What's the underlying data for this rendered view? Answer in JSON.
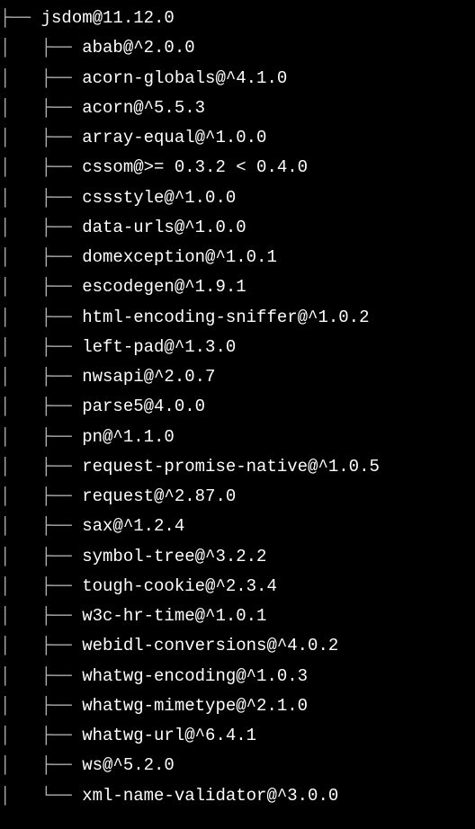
{
  "tree": {
    "root": "jsdom@11.12.0",
    "children": [
      "abab@^2.0.0",
      "acorn-globals@^4.1.0",
      "acorn@^5.5.3",
      "array-equal@^1.0.0",
      "cssom@>= 0.3.2 < 0.4.0",
      "cssstyle@^1.0.0",
      "data-urls@^1.0.0",
      "domexception@^1.0.1",
      "escodegen@^1.9.1",
      "html-encoding-sniffer@^1.0.2",
      "left-pad@^1.3.0",
      "nwsapi@^2.0.7",
      "parse5@4.0.0",
      "pn@^1.1.0",
      "request-promise-native@^1.0.5",
      "request@^2.87.0",
      "sax@^1.2.4",
      "symbol-tree@^3.2.2",
      "tough-cookie@^2.3.4",
      "w3c-hr-time@^1.0.1",
      "webidl-conversions@^4.0.2",
      "whatwg-encoding@^1.0.3",
      "whatwg-mimetype@^2.1.0",
      "whatwg-url@^6.4.1",
      "ws@^5.2.0",
      "xml-name-validator@^3.0.0"
    ],
    "branches": {
      "rootPrefix": "├──",
      "childPrefix": "│   ├──",
      "lastChildPrefix": "│   └──"
    }
  }
}
